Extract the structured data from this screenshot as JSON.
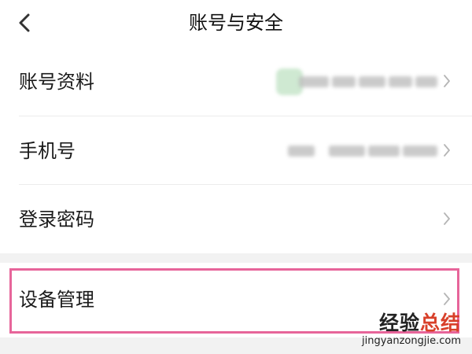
{
  "header": {
    "title": "账号与安全",
    "back_icon": "chevron-left-icon"
  },
  "settings": {
    "items": [
      {
        "label": "账号资料",
        "value": "",
        "icon": "chevron-right-icon"
      },
      {
        "label": "手机号",
        "value": "",
        "icon": "chevron-right-icon"
      },
      {
        "label": "登录密码",
        "icon": "chevron-right-icon"
      },
      {
        "label": "设备管理",
        "icon": "chevron-right-icon"
      }
    ]
  },
  "annotation": {
    "highlight_color": "#e7659a"
  },
  "watermark": {
    "title_part1": "经验",
    "title_part2": "总结",
    "url": "jingyanzongjie.com",
    "accent_color": "#d8402a"
  }
}
